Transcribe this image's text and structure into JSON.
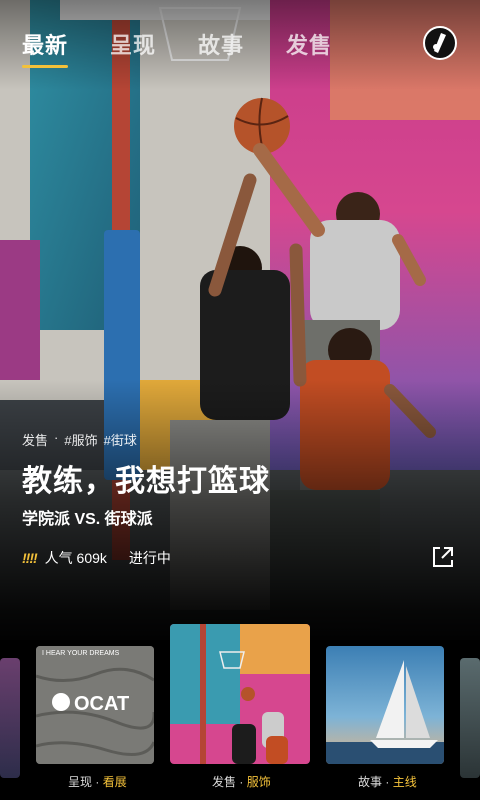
{
  "nav": {
    "tabs": [
      {
        "label": "最新",
        "active": true
      },
      {
        "label": "呈现",
        "active": false
      },
      {
        "label": "故事",
        "active": false
      },
      {
        "label": "发售",
        "active": false
      }
    ]
  },
  "hero": {
    "tags": [
      "发售",
      "·",
      "#服饰",
      "#街球"
    ],
    "title": "教练，我想打篮球",
    "subtitle": "学院派 VS. 街球派",
    "popularity_label": "人气 609k",
    "status": "进行中",
    "flame_glyph": "!!!!"
  },
  "cards": [
    {
      "category": "呈现",
      "sep": " · ",
      "name": "看展",
      "art_text": "I HEAR YOUR DREAMS",
      "art_logo": "OCAT"
    },
    {
      "category": "发售",
      "sep": " · ",
      "name": "服饰"
    },
    {
      "category": "故事",
      "sep": " · ",
      "name": "主线"
    }
  ],
  "colors": {
    "accent": "#f3c13a",
    "background": "#000000"
  }
}
